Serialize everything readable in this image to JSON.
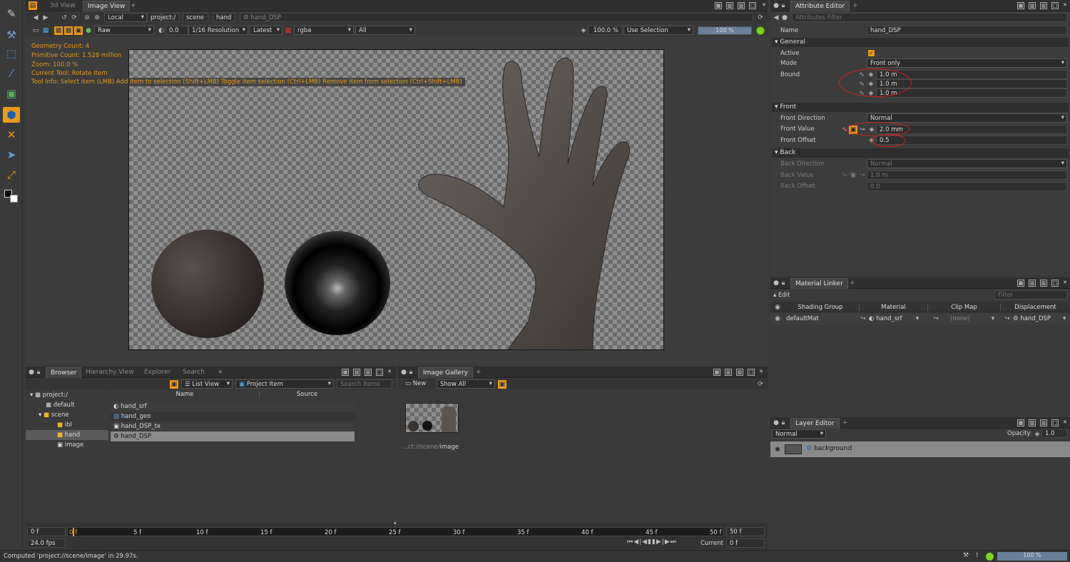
{
  "viewer": {
    "tabs": [
      "3d View",
      "Image View"
    ],
    "path": {
      "space": "Local",
      "crumbs": [
        "project:/",
        "scene",
        "hand"
      ],
      "current": "hand_DSP"
    },
    "toolbar": {
      "lut": "Raw",
      "exposure": "0.0",
      "resolution": "1/16 Resolution",
      "version": "Latest",
      "channel": "rgba",
      "layer": "All",
      "zoom": "100.0 %",
      "selection_mode": "Use Selection",
      "progress": "100 %"
    },
    "hud": [
      "Geometry Count: 4",
      "Primitive Count: 1.528 million",
      "Zoom: 100.0 %",
      "Current Tool: Rotate Item",
      "Tool Info: Select item (LMB)  Add item to selection (Shift+LMB)  Toggle item selection (Ctrl+LMB)  Remove item from selection (Ctrl+Shift+LMB)"
    ]
  },
  "browser": {
    "tabs": [
      "Browser",
      "Hierarchy View",
      "Explorer",
      "Search"
    ],
    "view_mode": "List View",
    "filter": "Project Item",
    "search_placeholder": "Search Items",
    "tree": [
      "project:/",
      "default",
      "scene",
      "ibl",
      "hand",
      "image"
    ],
    "columns": [
      "Name",
      "Source"
    ],
    "items": [
      "hand_srf",
      "hand_geo",
      "hand_DSP_tx",
      "hand_DSP"
    ]
  },
  "gallery": {
    "title": "Image Gallery",
    "new_label": "New",
    "show": "Show All",
    "caption_dim": "...ct://scene/",
    "caption_name": "image"
  },
  "timeline": {
    "start": "0 f",
    "current_marker": "0 f",
    "end": "50 f",
    "ticks": [
      "5 f",
      "10 f",
      "15 f",
      "20 f",
      "25 f",
      "30 f",
      "35 f",
      "40 f",
      "45 f",
      "50 f"
    ],
    "fps": "24.0 fps",
    "current_label": "Current",
    "current_value": "0 f"
  },
  "status": {
    "message": "Computed 'project://scene/image' in 29.97s.",
    "progress": "100 %"
  },
  "attr": {
    "title": "Attribute Editor",
    "filter_placeholder": "Attributes Filter",
    "name_label": "Name",
    "name_value": "hand_DSP",
    "general": "General",
    "active_label": "Active",
    "mode_label": "Mode",
    "mode_value": "Front only",
    "bound_label": "Bound",
    "bound_values": [
      "1.0 m",
      "1.0 m",
      "1.0 m"
    ],
    "front": "Front",
    "front_dir_label": "Front Direction",
    "front_dir_value": "Normal",
    "front_value_label": "Front Value",
    "front_value": "2.0 mm",
    "front_offset_label": "Front Offset",
    "front_offset": "0.5",
    "back": "Back",
    "back_dir_label": "Back Direction",
    "back_dir_value": "Normal",
    "back_value_label": "Back Value",
    "back_value": "1.0 m",
    "back_offset_label": "Back Offset",
    "back_offset": "0.0"
  },
  "material": {
    "title": "Material Linker",
    "edit": "Edit",
    "filter_placeholder": "Filter",
    "columns": [
      "Shading Group",
      "Material",
      "Clip Map",
      "Displacement"
    ],
    "row": {
      "group": "defaultMat",
      "material": "hand_srf",
      "clip": "(none)",
      "disp": "hand_DSP"
    }
  },
  "layers": {
    "title": "Layer Editor",
    "blend": "Normal",
    "opacity_label": "Opacity",
    "opacity": "1.0",
    "layer": "background"
  }
}
